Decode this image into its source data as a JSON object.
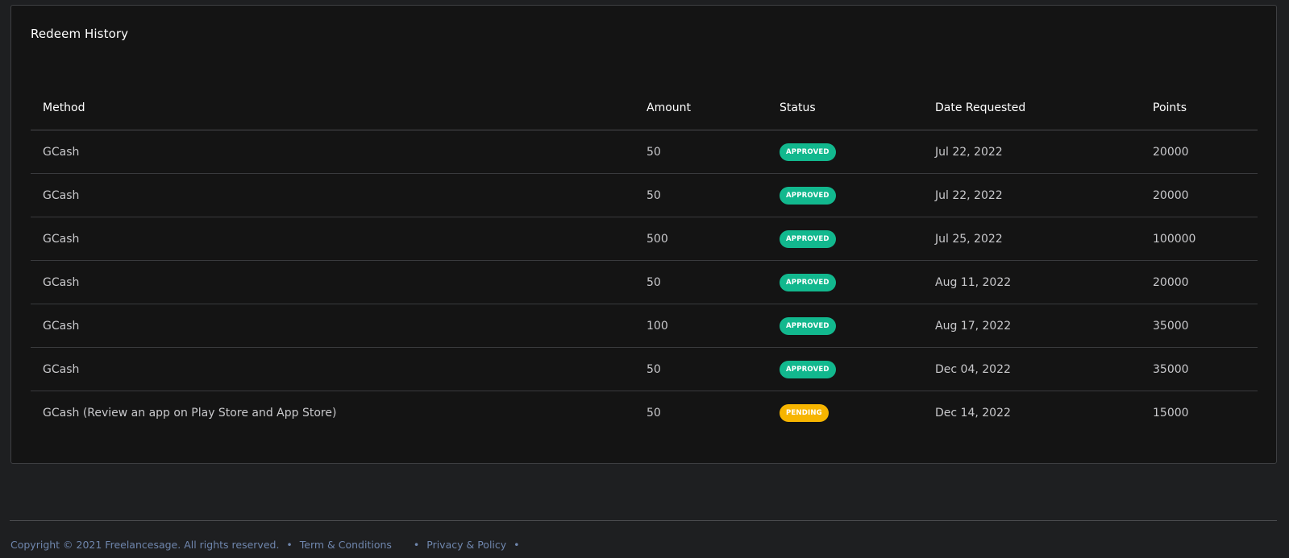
{
  "card": {
    "title": "Redeem History"
  },
  "table": {
    "headers": {
      "method": "Method",
      "amount": "Amount",
      "status": "Status",
      "date": "Date Requested",
      "points": "Points"
    },
    "rows": [
      {
        "method": "GCash",
        "amount": "50",
        "status": "APPROVED",
        "date": "Jul 22, 2022",
        "points": "20000"
      },
      {
        "method": "GCash",
        "amount": "50",
        "status": "APPROVED",
        "date": "Jul 22, 2022",
        "points": "20000"
      },
      {
        "method": "GCash",
        "amount": "500",
        "status": "APPROVED",
        "date": "Jul 25, 2022",
        "points": "100000"
      },
      {
        "method": "GCash",
        "amount": "50",
        "status": "APPROVED",
        "date": "Aug 11, 2022",
        "points": "20000"
      },
      {
        "method": "GCash",
        "amount": "100",
        "status": "APPROVED",
        "date": "Aug 17, 2022",
        "points": "35000"
      },
      {
        "method": "GCash",
        "amount": "50",
        "status": "APPROVED",
        "date": "Dec 04, 2022",
        "points": "35000"
      },
      {
        "method": "GCash (Review an app on Play Store and App Store)",
        "amount": "50",
        "status": "PENDING",
        "date": "Dec 14, 2022",
        "points": "15000"
      }
    ]
  },
  "footer": {
    "copyright": "Copyright © 2021 Freelancesage. All rights reserved.",
    "bullet": "•",
    "terms_link": "Term & Conditions",
    "privacy_link": "Privacy & Policy"
  },
  "colors": {
    "approved": "#12b88e",
    "pending": "#f7b500",
    "footer_link": "#6f86ad"
  }
}
